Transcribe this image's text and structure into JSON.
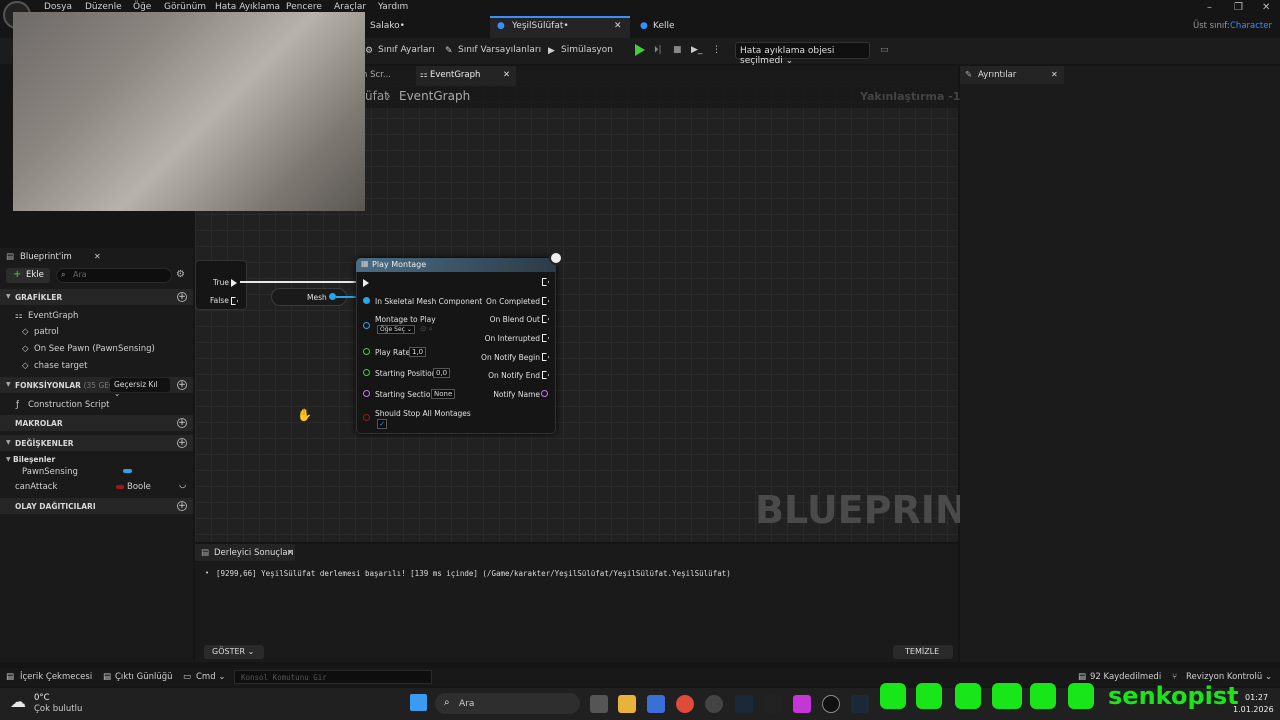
{
  "menu": [
    "Dosya",
    "Düzenle",
    "Öğe",
    "Görünüm",
    "Hata Ayıklama",
    "Pencere",
    "Araçlar",
    "Yardım"
  ],
  "tabs": [
    "Salako•",
    "YeşilSülüfat•",
    "Kelle"
  ],
  "parent_class_label": "Üst sınıf:",
  "parent_class_value": "Character",
  "toolbar": {
    "class_settings": "Sınıf Ayarları",
    "class_defaults": "Sınıf Varsayılanları",
    "simulation": "Simülasyon",
    "debug_select": "Hata ayıklama objesi seçilmedi"
  },
  "graph": {
    "tab_prev": "n Scr...",
    "tab_active": "EventGraph",
    "breadcrumb_prev": "üfat",
    "breadcrumb_current": "EventGraph",
    "zoom": "Yakınlaştırma -1",
    "watermark": "BLUEPRINT"
  },
  "branch": {
    "true": "True",
    "false": "False"
  },
  "mesh_var": "Mesh",
  "node": {
    "title": "Play Montage",
    "in_skeletal": "In Skeletal Mesh Component",
    "montage_to_play": "Montage to Play",
    "montage_select": "Öğe Seç",
    "play_rate": "Play Rate",
    "play_rate_val": "1,0",
    "starting_pos": "Starting Position",
    "starting_pos_val": "0,0",
    "starting_section": "Starting Section",
    "starting_section_val": "None",
    "should_stop": "Should Stop All Montages",
    "outputs": [
      "On Completed",
      "On Blend Out",
      "On Interrupted",
      "On Notify Begin",
      "On Notify End",
      "Notify Name"
    ]
  },
  "left_panel": {
    "title": "Blueprint'im",
    "add": "Ekle",
    "search_placeholder": "Ara",
    "graphs_header": "GRAFİKLER",
    "event_graph": "EventGraph",
    "events": [
      "patrol",
      "On See Pawn (PawnSensing)",
      "chase target"
    ],
    "functions_header": "FONKSİYONLAR",
    "functions_count": "(35 GEÇERSİ",
    "override": "Geçersiz Kıl",
    "construction": "Construction Script",
    "macros_header": "MAKROLAR",
    "vars_header": "DEĞİŞKENLER",
    "components_label": "Bileşenler",
    "pawn_sensing": "PawnSensing",
    "can_attack": "canAttack",
    "can_attack_type": "Boole",
    "dispatchers_header": "OLAY DAĞITICILARI"
  },
  "details": {
    "title": "Ayrıntılar"
  },
  "results": {
    "tab": "Derleyici Sonuçları",
    "message": "[9299,66] YeşilSülüfat derlemesi başarılı! [139 ms içinde] (/Game/karakter/YeşilSülüfat/YeşilSülüfat.YeşilSülüfat)",
    "show": "GÖSTER",
    "clear": "TEMİZLE"
  },
  "statusbar": {
    "content_drawer": "İçerik Çekmecesi",
    "output_log": "Çıktı Günlüğü",
    "cmd": "Cmd",
    "console_placeholder": "Konsol Komutunu Gir",
    "saved": "92 Kaydedilmedi",
    "revision": "Revizyon Kontrolü"
  },
  "taskbar": {
    "weather_temp": "0°C",
    "weather_desc": "Çok bulutlu",
    "search": "Ara",
    "time": "01:27",
    "date": "1.01.2026",
    "brand": "senkopist"
  },
  "colors": {
    "accent": "#3a8cff",
    "play": "#3ecf3e",
    "social": "#19e619"
  }
}
